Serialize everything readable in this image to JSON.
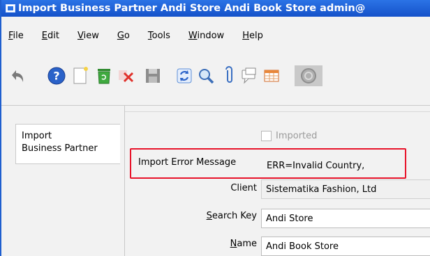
{
  "window": {
    "title": "Import Business Partner  Andi Store  Andi Book Store  admin@"
  },
  "menu": {
    "items": [
      {
        "pre": "",
        "u": "F",
        "post": "ile"
      },
      {
        "pre": "",
        "u": "E",
        "post": "dit"
      },
      {
        "pre": "",
        "u": "V",
        "post": "iew"
      },
      {
        "pre": "",
        "u": "G",
        "post": "o"
      },
      {
        "pre": "",
        "u": "T",
        "post": "ools"
      },
      {
        "pre": "",
        "u": "W",
        "post": "indow"
      },
      {
        "pre": "",
        "u": "H",
        "post": "elp"
      }
    ]
  },
  "toolbar": {
    "icons": [
      "undo-icon",
      "help-icon",
      "new-record-icon",
      "copy-record-icon",
      "delete-icon",
      "save-icon",
      "refresh-icon",
      "find-icon",
      "attachment-icon",
      "chat-icon",
      "grid-toggle-icon",
      "workflow-icon"
    ]
  },
  "tab": {
    "label_line1": "Import",
    "label_line2": "Business Partner"
  },
  "form": {
    "imported_label": "Imported",
    "import_error_label": "Import Error Message",
    "import_error_value": "ERR=Invalid Country,",
    "client_label": "Client",
    "client_value": "Sistematika Fashion, Ltd",
    "search_key_label": {
      "pre": "",
      "u": "S",
      "post": "earch Key"
    },
    "search_key_value": "Andi Store",
    "name_label": {
      "pre": "",
      "u": "N",
      "post": "ame"
    },
    "name_value": "Andi Book Store"
  },
  "colors": {
    "titlebar": "#1f5fcf",
    "highlight": "#e8132a"
  }
}
